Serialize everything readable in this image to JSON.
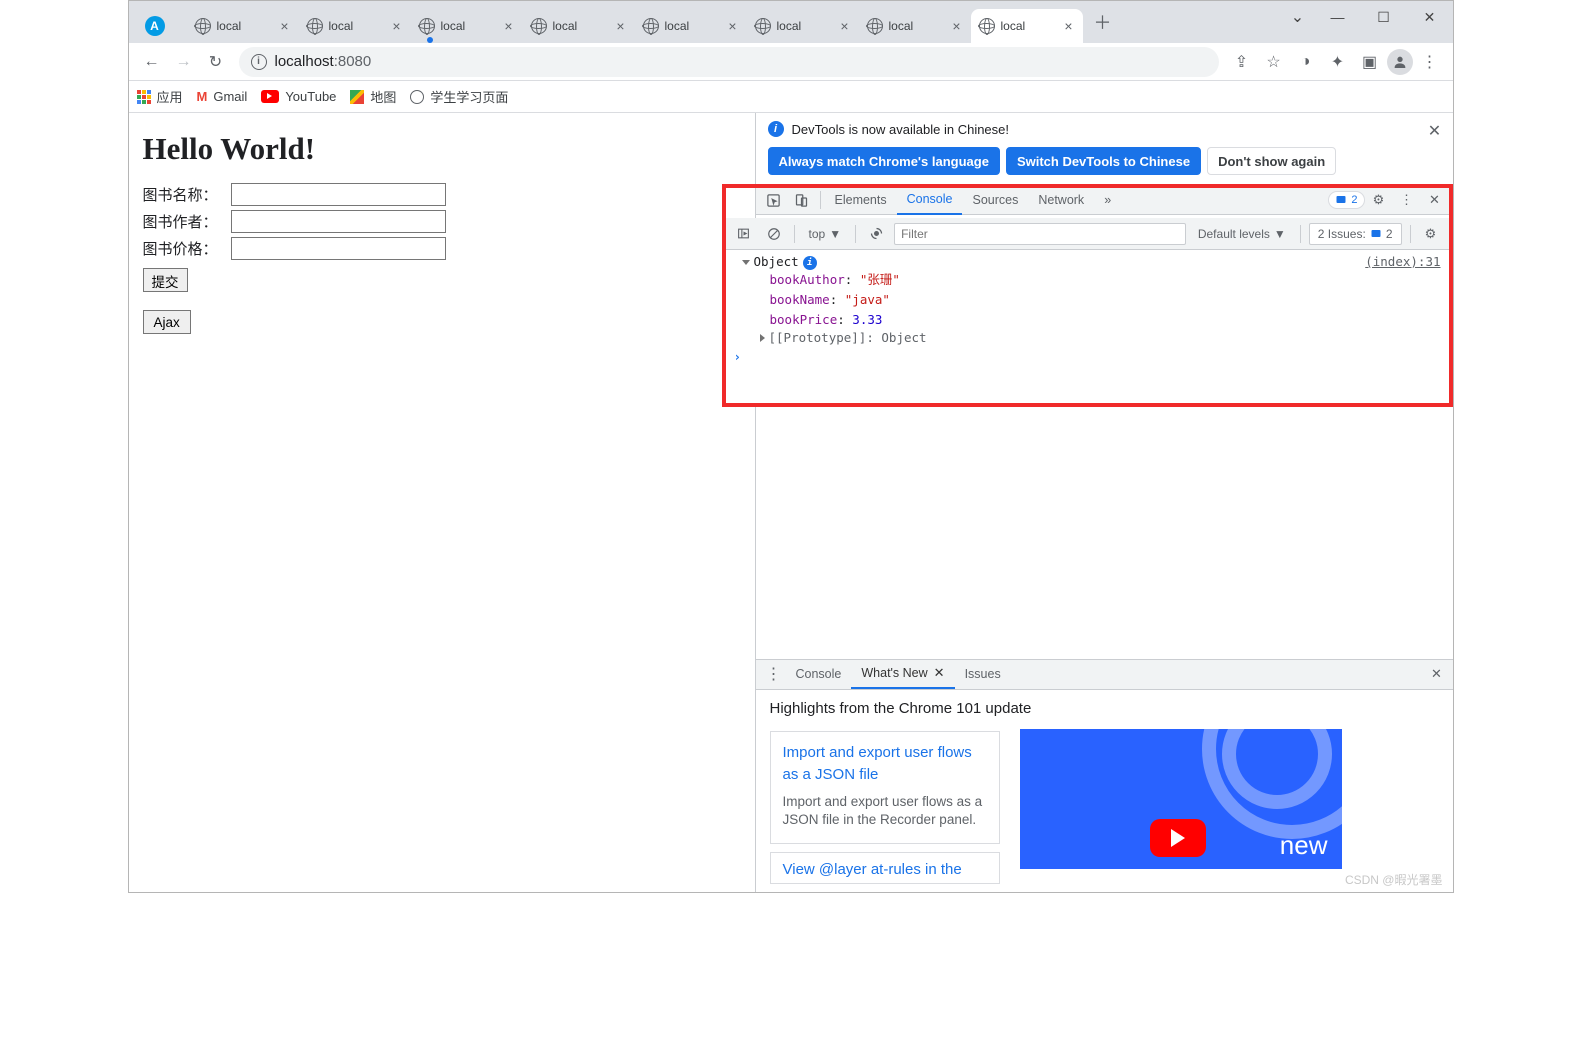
{
  "tabs": [
    {
      "title": "",
      "close": ""
    },
    {
      "title": "local",
      "close": "×"
    },
    {
      "title": "local",
      "close": "×"
    },
    {
      "title": "local",
      "close": "×",
      "loading": true
    },
    {
      "title": "local",
      "close": "×"
    },
    {
      "title": "local",
      "close": "×"
    },
    {
      "title": "local",
      "close": "×"
    },
    {
      "title": "local",
      "close": "×"
    },
    {
      "title": "local",
      "close": "×",
      "active": true
    }
  ],
  "newtab_plus": "＋",
  "win_controls": {
    "chev": "⌄",
    "min": "—",
    "max": "☐",
    "close": "✕"
  },
  "toolbar": {
    "back": "←",
    "forward": "→",
    "reload": "↻",
    "url_host": "localhost",
    "url_port": ":8080",
    "share": "⇪",
    "star": "☆",
    "ext1": "◑",
    "ext2": "✦",
    "side": "▣",
    "menu": "⋮"
  },
  "bookmarks": {
    "apps": "应用",
    "gmail": "Gmail",
    "youtube": "YouTube",
    "maps": "地图",
    "student": "学生学习页面"
  },
  "page": {
    "heading": "Hello World!",
    "book_name_label": "图书名称：",
    "book_author_label": "图书作者：",
    "book_price_label": "图书价格：",
    "submit": "提交",
    "ajax": "Ajax"
  },
  "devtools": {
    "banner": {
      "msg": "DevTools is now available in Chinese!",
      "btn1": "Always match Chrome's language",
      "btn2": "Switch DevTools to Chinese",
      "btn3": "Don't show again",
      "close": "✕"
    },
    "tabs": {
      "elements": "Elements",
      "console": "Console",
      "sources": "Sources",
      "network": "Network",
      "more": "»",
      "badge_count": "2",
      "settings": "⚙",
      "menu": "⋮",
      "close": "✕"
    },
    "console": {
      "toolbar": {
        "context": "top",
        "levels": "Default levels",
        "issues_label": "2 Issues:",
        "issues_count": "2",
        "filter_placeholder": "Filter"
      },
      "object": {
        "head": "Object",
        "src": "(index):31",
        "props": [
          {
            "key": "bookAuthor",
            "val": "\"张珊\"",
            "type": "str"
          },
          {
            "key": "bookName",
            "val": "\"java\"",
            "type": "str"
          },
          {
            "key": "bookPrice",
            "val": "3.33",
            "type": "num"
          }
        ],
        "proto_label": "[[Prototype]]",
        "proto_val": "Object"
      },
      "prompt": "›"
    },
    "drawer": {
      "tabs": {
        "console": "Console",
        "whatsnew": "What's New",
        "issues": "Issues",
        "close": "✕"
      },
      "heading": "Highlights from the Chrome 101 update",
      "card1": {
        "title": "Import and export user flows as a JSON file",
        "desc": "Import and export user flows as a JSON file in the Recorder panel."
      },
      "card2": {
        "title": "View @layer at-rules in the"
      },
      "promo_new": "new"
    }
  },
  "watermark": "CSDN @暇光署墨"
}
